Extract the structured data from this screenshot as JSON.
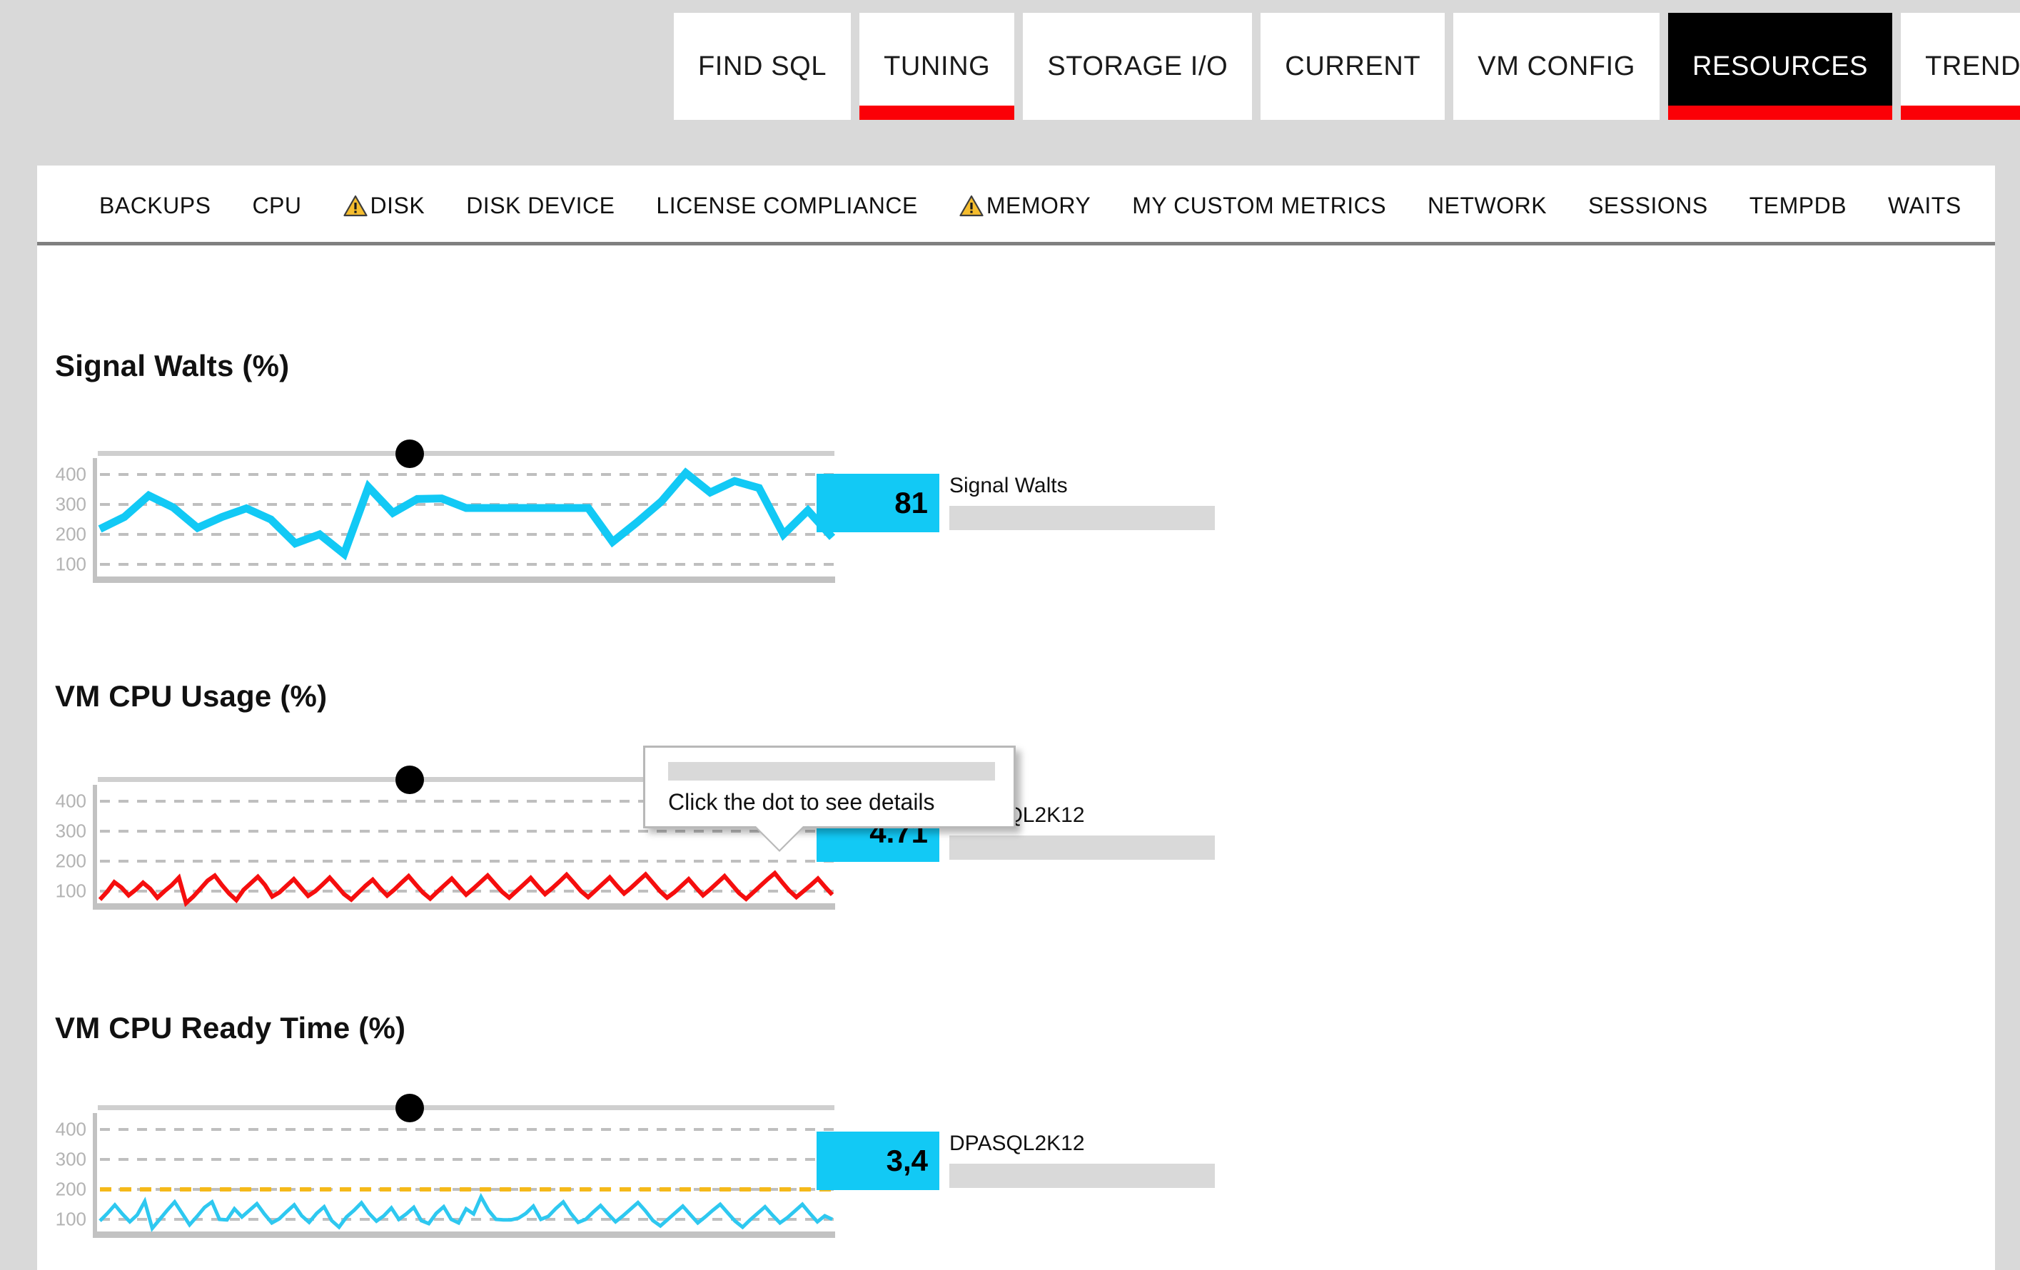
{
  "top_nav": {
    "tabs": [
      {
        "label": "TRENDS",
        "active": false,
        "selected": false
      },
      {
        "label": "FIND SQL",
        "active": false,
        "selected": false
      },
      {
        "label": "TUNING",
        "active": true,
        "selected": false
      },
      {
        "label": "STORAGE I/O",
        "active": false,
        "selected": false
      },
      {
        "label": "CURRENT",
        "active": false,
        "selected": false
      },
      {
        "label": "VM CONFIG",
        "active": false,
        "selected": false
      },
      {
        "label": "RESOURCES",
        "active": true,
        "selected": true
      }
    ]
  },
  "sub_nav": {
    "items": [
      {
        "label": "BACKUPS",
        "warning": false
      },
      {
        "label": "CPU",
        "warning": false
      },
      {
        "label": "DISK",
        "warning": true
      },
      {
        "label": "DISK DEVICE",
        "warning": false
      },
      {
        "label": "LICENSE COMPLIANCE",
        "warning": false
      },
      {
        "label": "MEMORY",
        "warning": true
      },
      {
        "label": "MY CUSTOM METRICS",
        "warning": false
      },
      {
        "label": "NETWORK",
        "warning": false
      },
      {
        "label": "SESSIONS",
        "warning": false
      },
      {
        "label": "TEMPDB",
        "warning": false
      },
      {
        "label": "WAITS",
        "warning": false
      }
    ]
  },
  "tooltip": {
    "text": "Click the dot to see details"
  },
  "colors": {
    "accent_cyan": "#12c9f5",
    "line_red": "#f50e0e",
    "threshold_yellow": "#f5b919",
    "grid_gray": "#bfbfbf",
    "tab_underline_red": "#fb0007",
    "page_background": "#d9d9d9"
  },
  "charts": [
    {
      "title": "Signal Walts (%)",
      "legend": {
        "value": "81",
        "name": "Signal Walts"
      }
    },
    {
      "title": "VM CPU Usage (%)",
      "legend": {
        "value": "4.71",
        "name": "DPASQL2K12"
      }
    },
    {
      "title": "VM CPU Ready Time (%)",
      "legend": {
        "value": "3,4",
        "name": "DPASQL2K12"
      }
    }
  ],
  "chart_data": [
    {
      "type": "line",
      "title": "Signal Walts (%)",
      "xlabel": "",
      "ylabel": "",
      "ylim": [
        0,
        450
      ],
      "yticks": [
        100,
        200,
        300,
        400
      ],
      "grid": true,
      "legend_position": "right",
      "color": "#12c9f5",
      "series": [
        {
          "name": "Signal Walts",
          "values": [
            218,
            258,
            330,
            290,
            222,
            258,
            287,
            250,
            170,
            200,
            135,
            358,
            272,
            318,
            320,
            288,
            288,
            288,
            288,
            288,
            288,
            175,
            240,
            310,
            405,
            340,
            378,
            355,
            200,
            280,
            190
          ]
        }
      ]
    },
    {
      "type": "line",
      "title": "VM CPU Usage (%)",
      "xlabel": "",
      "ylabel": "",
      "ylim": [
        0,
        450
      ],
      "yticks": [
        100,
        200,
        300,
        400
      ],
      "grid": true,
      "legend_position": "right",
      "color": "#f50e0e",
      "series": [
        {
          "name": "DPASQL2K12",
          "values": [
            72,
            98,
            130,
            112,
            86,
            105,
            128,
            108,
            78,
            100,
            120,
            145,
            60,
            82,
            108,
            135,
            152,
            120,
            92,
            70,
            104,
            126,
            148,
            120,
            82,
            96,
            118,
            140,
            112,
            84,
            100,
            122,
            145,
            118,
            90,
            72,
            95,
            118,
            138,
            110,
            85,
            105,
            128,
            150,
            122,
            95,
            75,
            98,
            120,
            142,
            115,
            88,
            108,
            130,
            152,
            125,
            98,
            78,
            100,
            122,
            144,
            116,
            90,
            110,
            132,
            155,
            128,
            100,
            80,
            102,
            124,
            146,
            118,
            92,
            112,
            134,
            156,
            128,
            100,
            78,
            96,
            118,
            140,
            112,
            86,
            106,
            128,
            150,
            122,
            94,
            74,
            96,
            118,
            140,
            160,
            130,
            102,
            80,
            100,
            120,
            142,
            114,
            88
          ]
        }
      ]
    },
    {
      "type": "line",
      "title": "VM CPU Ready Time (%)",
      "xlabel": "",
      "ylabel": "",
      "ylim": [
        0,
        450
      ],
      "yticks": [
        100,
        200,
        300,
        400
      ],
      "grid": true,
      "threshold": {
        "value": 200,
        "color": "#f5b919",
        "style": "dashed"
      },
      "legend_position": "right",
      "color": "#2ec8f0",
      "series": [
        {
          "name": "DPASQL2K12",
          "values": [
            95,
            120,
            148,
            118,
            92,
            115,
            160,
            70,
            100,
            130,
            158,
            120,
            82,
            110,
            140,
            158,
            100,
            98,
            135,
            108,
            130,
            152,
            118,
            88,
            102,
            126,
            148,
            112,
            90,
            120,
            142,
            96,
            74,
            108,
            130,
            155,
            120,
            94,
            112,
            138,
            100,
            118,
            140,
            96,
            86,
            120,
            142,
            100,
            88,
            135,
            118,
            175,
            130,
            100,
            98,
            98,
            104,
            120,
            144,
            100,
            110,
            136,
            158,
            120,
            90,
            100,
            124,
            146,
            118,
            92,
            112,
            134,
            156,
            128,
            96,
            78,
            100,
            122,
            144,
            116,
            88,
            108,
            130,
            150,
            122,
            94,
            74,
            98,
            120,
            142,
            114,
            88,
            106,
            128,
            150,
            120,
            92,
            112,
            100
          ]
        }
      ]
    }
  ]
}
